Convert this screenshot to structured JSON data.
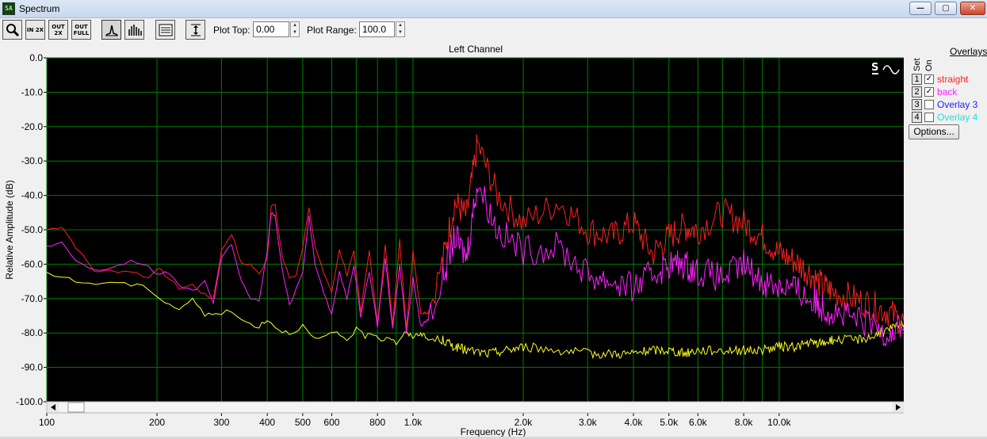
{
  "window": {
    "title": "Spectrum",
    "icon": "app-icon"
  },
  "toolbar": {
    "buttons": [
      {
        "name": "zoom-button",
        "icon": "magnifier-icon",
        "text": ""
      },
      {
        "name": "zoom-in-2x-button",
        "icon": "zoom-in-icon",
        "text": "IN 2X"
      },
      {
        "name": "zoom-out-2x-button",
        "icon": "zoom-out-icon",
        "text": "OUT 2X"
      },
      {
        "name": "zoom-out-full-button",
        "icon": "zoom-full-icon",
        "text": "OUT FULL"
      },
      {
        "name": "line-mode-button",
        "icon": "line-plot-icon",
        "text": ""
      },
      {
        "name": "bar-mode-button",
        "icon": "bar-plot-icon",
        "text": ""
      },
      {
        "name": "settings-button",
        "icon": "settings-panel-icon",
        "text": ""
      },
      {
        "name": "autoscale-button",
        "icon": "vertical-scale-icon",
        "text": ""
      }
    ],
    "plot_top_label": "Plot Top:",
    "plot_top_value": "0.00",
    "plot_range_label": "Plot Range:",
    "plot_range_value": "100.0"
  },
  "overlays": {
    "title": "Overlays",
    "set_header": "Set",
    "on_header": "On",
    "items": [
      {
        "set": "1",
        "checked": true,
        "name": "straight",
        "color": "#ff2020"
      },
      {
        "set": "2",
        "checked": true,
        "name": "back",
        "color": "#ff20ff"
      },
      {
        "set": "3",
        "checked": false,
        "name": "Overlay 3",
        "color": "#2020ff"
      },
      {
        "set": "4",
        "checked": false,
        "name": "Overlay 4",
        "color": "#20ffff"
      }
    ],
    "options_label": "Options..."
  },
  "chart_data": {
    "type": "line",
    "title": "Left Channel",
    "xlabel": "Frequency (Hz)",
    "ylabel": "Relative Amplitude (dB)",
    "xscale": "log",
    "xlim": [
      100,
      22000
    ],
    "ylim": [
      -100,
      0
    ],
    "grid": true,
    "background": "#000000",
    "grid_color": "#008000",
    "yticks": [
      "0.0",
      "-10.0",
      "-20.0",
      "-30.0",
      "-40.0",
      "-50.0",
      "-60.0",
      "-70.0",
      "-80.0",
      "-90.0",
      "-100.0"
    ],
    "ytick_values": [
      0,
      -10,
      -20,
      -30,
      -40,
      -50,
      -60,
      -70,
      -80,
      -90,
      -100
    ],
    "xticks": [
      {
        "v": 100,
        "l": "100"
      },
      {
        "v": 200,
        "l": "200"
      },
      {
        "v": 300,
        "l": "300"
      },
      {
        "v": 400,
        "l": "400"
      },
      {
        "v": 500,
        "l": "500"
      },
      {
        "v": 600,
        "l": "600"
      },
      {
        "v": 800,
        "l": "800"
      },
      {
        "v": 1000,
        "l": "1.0k"
      },
      {
        "v": 2000,
        "l": "2.0k"
      },
      {
        "v": 3000,
        "l": "3.0k"
      },
      {
        "v": 4000,
        "l": "4.0k"
      },
      {
        "v": 5000,
        "l": "5.0k"
      },
      {
        "v": 6000,
        "l": "6.0k"
      },
      {
        "v": 8000,
        "l": "8.0k"
      },
      {
        "v": 10000,
        "l": "10.0k"
      }
    ],
    "minor_grid_x": [
      700,
      900,
      7000,
      9000
    ],
    "series": [
      {
        "name": "straight",
        "color": "#ff2020",
        "x": [
          100,
          110,
          120,
          135,
          150,
          170,
          190,
          200,
          210,
          230,
          250,
          270,
          285,
          300,
          320,
          340,
          360,
          380,
          400,
          410,
          420,
          440,
          460,
          480,
          500,
          520,
          540,
          570,
          600,
          630,
          660,
          690,
          720,
          760,
          800,
          840,
          880,
          920,
          960,
          1000,
          1050,
          1100,
          1200,
          1300,
          1400,
          1500,
          1700,
          2000,
          2500,
          3000,
          3500,
          4000,
          4500,
          5000,
          5500,
          6000,
          7000,
          8000,
          9000,
          10000,
          11000,
          12000,
          13000,
          14000,
          16000,
          18000,
          20000,
          22000
        ],
        "y": [
          -50,
          -49,
          -55,
          -62,
          -62,
          -62,
          -64,
          -61,
          -63,
          -67,
          -66,
          -69,
          -70,
          -56,
          -51,
          -60,
          -60,
          -63,
          -58,
          -43,
          -43,
          -58,
          -64,
          -63,
          -55,
          -44,
          -55,
          -62,
          -68,
          -56,
          -63,
          -56,
          -74,
          -56,
          -78,
          -54,
          -78,
          -53,
          -79,
          -56,
          -74,
          -74,
          -60,
          -42,
          -46,
          -25,
          -40,
          -48,
          -42,
          -50,
          -52,
          -48,
          -57,
          -52,
          -49,
          -50,
          -45,
          -48,
          -52,
          -57,
          -59,
          -62,
          -66,
          -68,
          -70,
          -72,
          -74,
          -77
        ]
      },
      {
        "name": "back",
        "color": "#ff20ff",
        "x": [
          100,
          110,
          120,
          135,
          150,
          170,
          190,
          200,
          210,
          230,
          250,
          270,
          285,
          300,
          320,
          340,
          360,
          380,
          400,
          410,
          420,
          440,
          460,
          480,
          500,
          520,
          540,
          570,
          600,
          630,
          660,
          690,
          720,
          760,
          800,
          840,
          880,
          920,
          960,
          1000,
          1050,
          1100,
          1200,
          1300,
          1400,
          1500,
          1700,
          2000,
          2500,
          3000,
          3500,
          4000,
          4500,
          5000,
          5500,
          6000,
          7000,
          8000,
          9000,
          10000,
          11000,
          12000,
          13000,
          14000,
          16000,
          18000,
          20000,
          22000
        ],
        "y": [
          -55,
          -54,
          -59,
          -62,
          -61,
          -59,
          -61,
          -63,
          -62,
          -66,
          -68,
          -65,
          -71,
          -58,
          -54,
          -65,
          -70,
          -71,
          -56,
          -45,
          -46,
          -62,
          -72,
          -67,
          -62,
          -46,
          -60,
          -68,
          -75,
          -62,
          -70,
          -60,
          -75,
          -62,
          -78,
          -58,
          -79,
          -60,
          -80,
          -64,
          -78,
          -76,
          -65,
          -52,
          -58,
          -36,
          -50,
          -56,
          -55,
          -63,
          -65,
          -67,
          -63,
          -60,
          -60,
          -62,
          -64,
          -60,
          -65,
          -66,
          -67,
          -70,
          -72,
          -74,
          -76,
          -78,
          -80,
          -77
        ]
      },
      {
        "name": "",
        "color": "#ffff20",
        "x": [
          100,
          115,
          130,
          150,
          170,
          190,
          210,
          230,
          250,
          270,
          290,
          320,
          350,
          380,
          400,
          430,
          460,
          500,
          540,
          580,
          620,
          660,
          700,
          740,
          780,
          820,
          860,
          900,
          950,
          1000,
          1050,
          1100,
          1200,
          1300,
          1400,
          1600,
          1800,
          2000,
          2500,
          3000,
          3500,
          4000,
          4500,
          5000,
          5500,
          6000,
          7000,
          8000,
          9000,
          10000,
          11000,
          12000,
          13000,
          14000,
          16000,
          18000,
          20000,
          22000
        ],
        "y": [
          -63,
          -64,
          -66,
          -65,
          -66,
          -67,
          -71,
          -73,
          -70,
          -75,
          -74,
          -74,
          -77,
          -78,
          -76,
          -79,
          -80,
          -78,
          -82,
          -81,
          -80,
          -82,
          -79,
          -81,
          -80,
          -82,
          -81,
          -83,
          -80,
          -81,
          -80,
          -82,
          -82,
          -84,
          -85,
          -86,
          -85,
          -84,
          -85,
          -86,
          -86,
          -86,
          -85,
          -85,
          -86,
          -85,
          -85,
          -85,
          -85,
          -84,
          -84,
          -83,
          -83,
          -82,
          -82,
          -81,
          -79,
          -77
        ]
      }
    ]
  }
}
